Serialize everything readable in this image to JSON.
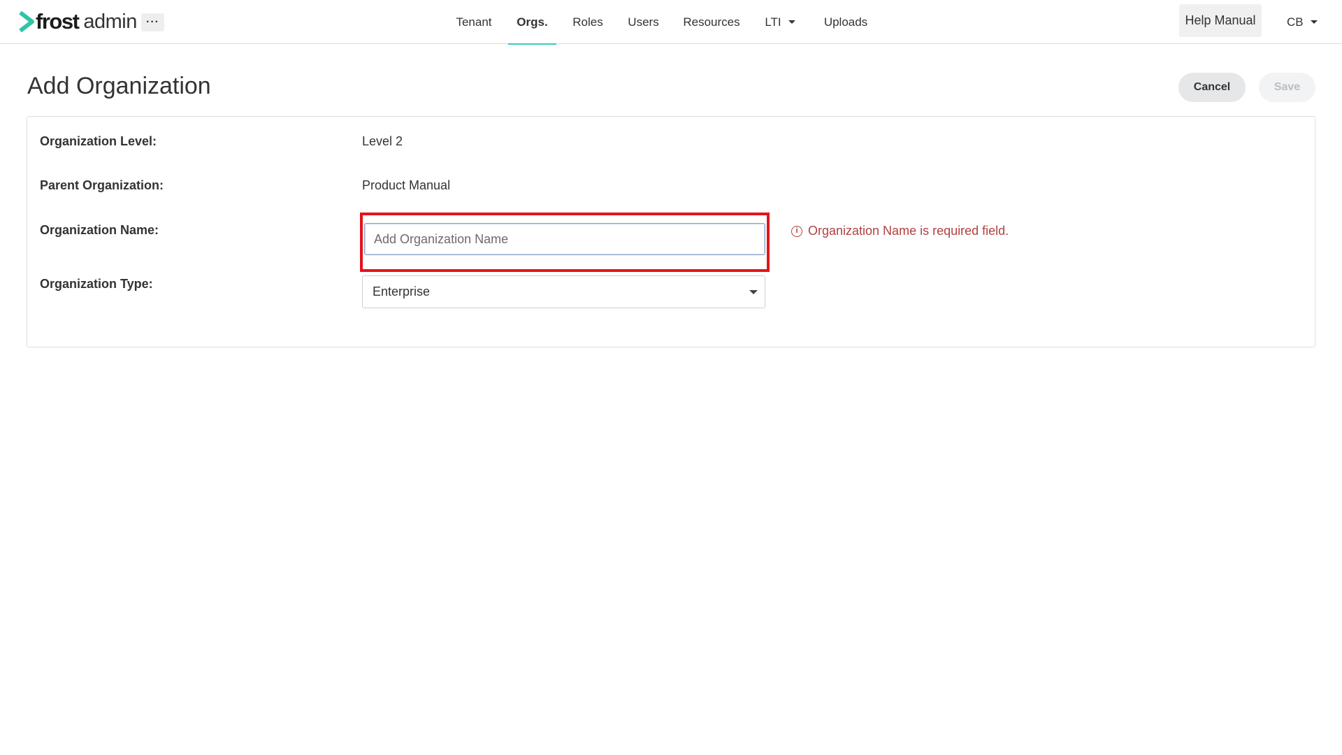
{
  "app": {
    "logo_primary": "frost",
    "logo_secondary": "admin",
    "more_label": "···",
    "accent_color": "#38c7c0"
  },
  "nav": {
    "items": [
      {
        "label": "Tenant"
      },
      {
        "label": "Orgs.",
        "active": true
      },
      {
        "label": "Roles"
      },
      {
        "label": "Users"
      },
      {
        "label": "Resources"
      },
      {
        "label": "LTI",
        "has_dropdown": true
      },
      {
        "label": "Uploads"
      }
    ],
    "help_label": "Help Manual",
    "user_initials": "CB"
  },
  "page": {
    "title": "Add Organization",
    "cancel_label": "Cancel",
    "save_label": "Save"
  },
  "form": {
    "level_label": "Organization Level:",
    "level_value": "Level 2",
    "parent_label": "Parent Organization:",
    "parent_value": "Product Manual",
    "name_label": "Organization Name:",
    "name_value": "",
    "name_placeholder": "Add Organization Name",
    "name_error": "Organization Name is required field.",
    "error_color": "#b04040",
    "type_label": "Organization Type:",
    "type_value": "Enterprise"
  }
}
